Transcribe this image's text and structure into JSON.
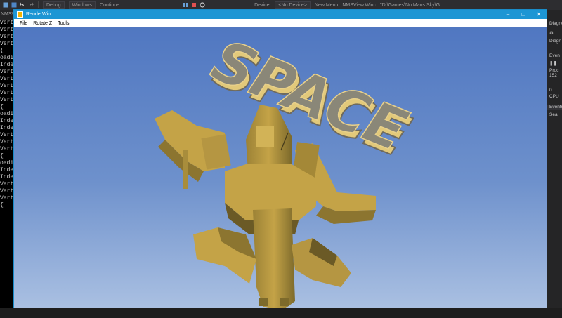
{
  "ide": {
    "toolbar": {
      "debug_label": "Debug",
      "windows_label": "Windows",
      "continue_label": "Continue",
      "device_label": "Device:",
      "device_value": "<No Device>",
      "new_menu_label": "New Menu",
      "nmsview_label": "NMSView.Winc",
      "path_label": "\"D:\\Games\\No Mans Sky\\G"
    },
    "left_console": {
      "tab_label": "NMSView",
      "lines": [
        "Verte",
        "Verte",
        "Verte",
        "Verte",
        "{",
        "oading",
        "Index",
        "Verte",
        "Verte",
        "Verte",
        "Verte",
        "Verte",
        "{",
        "oading",
        "Index",
        "Index",
        "Verte",
        "Verte",
        "Verte",
        "{",
        "oading",
        "Index",
        "Index",
        "Verte",
        "Verte",
        "Verte",
        "{"
      ]
    },
    "right_panel": {
      "diag_label": "Diagnos",
      "diag_sub": "Diagn",
      "events_label": "Even",
      "process_label": "Proc",
      "process_value": "152",
      "zero_label": "0",
      "cpu_label": "CPU",
      "events_tab": "Events",
      "search_label": "Sea"
    }
  },
  "window": {
    "title": "RenderWin",
    "menu": [
      "File",
      "Rotate Z",
      "Tools"
    ],
    "minimize": "–",
    "maximize": "□",
    "close": "✕"
  },
  "scene": {
    "banner_text": "SPACE",
    "colors": {
      "sky_top": "#5077c1",
      "sky_bottom": "#aac0e2",
      "ship": "#c4a347",
      "ship_shadow": "#8c7530",
      "ship_dark": "#6b5a26",
      "letters": "#8a8778",
      "letters_edge": "#e2c97a"
    }
  }
}
